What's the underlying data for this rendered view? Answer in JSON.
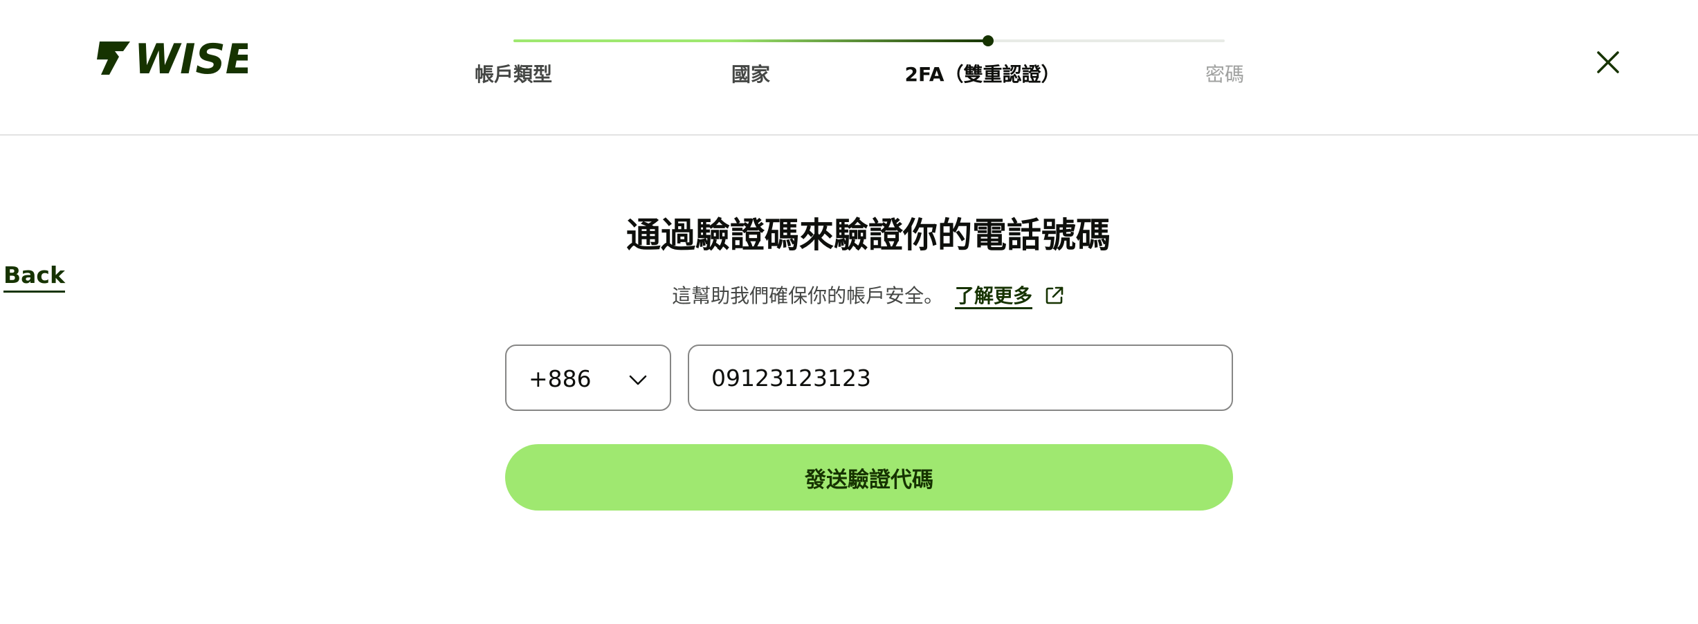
{
  "brand": {
    "logo_text": "WISE",
    "color_primary": "#163300",
    "color_accent": "#9fe870"
  },
  "stepper": {
    "progress_fraction": 0.667,
    "steps": [
      {
        "label": "帳戶類型",
        "state": "done"
      },
      {
        "label": "國家",
        "state": "done"
      },
      {
        "label": "2FA（雙重認證）",
        "state": "current"
      },
      {
        "label": "密碼",
        "state": "todo"
      }
    ]
  },
  "header": {
    "close_icon": "close-icon"
  },
  "nav": {
    "back_label": "Back"
  },
  "main": {
    "title": "通過驗證碼來驗證你的電話號碼",
    "subtitle": "這幫助我們確保你的帳戶安全。",
    "learn_more_label": "了解更多",
    "learn_more_icon": "external-link-icon",
    "country_code": "+886",
    "country_code_icon": "chevron-down-icon",
    "phone_value": "09123123123",
    "send_button_label": "發送驗證代碼"
  }
}
